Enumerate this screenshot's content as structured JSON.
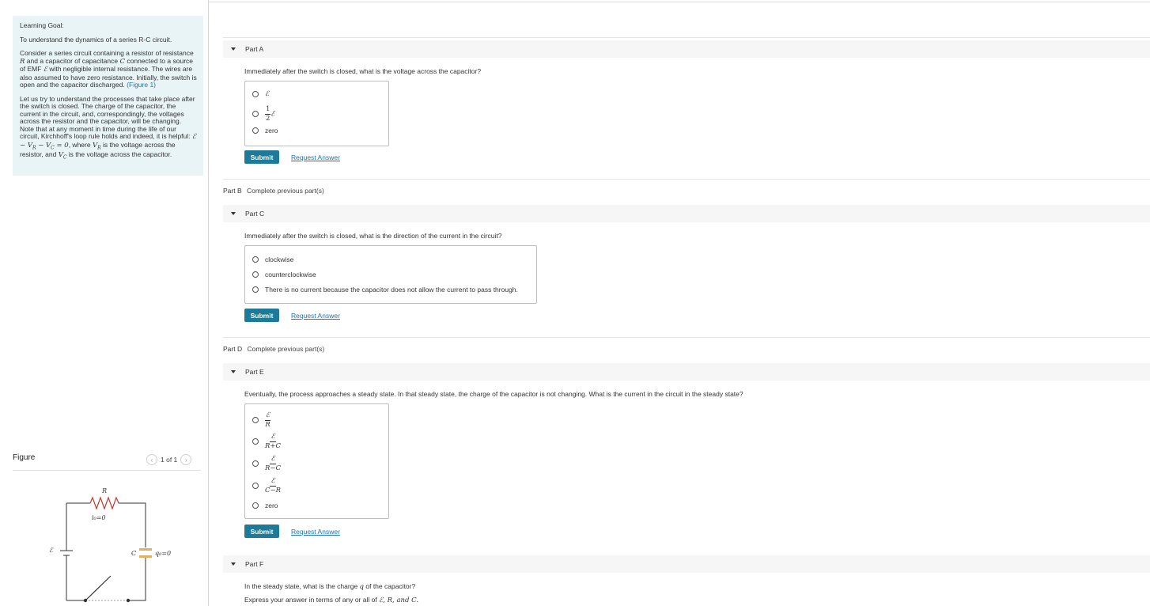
{
  "learning_goal": {
    "heading": "Learning Goal:",
    "intro": "To understand the dynamics of a series R-C circuit.",
    "p2_a": "Consider a series circuit containing a resistor of resistance",
    "p2_b": "and a capacitor of capacitance",
    "p2_c": "connected to a source of EMF",
    "p2_d": "with negligible internal resistance. The wires are also assumed to have zero resistance. Initially, the switch is open and the capacitor discharged.",
    "figure_link": "(Figure 1)",
    "p3_a": "Let us try to understand the processes that take place after the switch is closed. The charge of the capacitor, the current in the circuit, and, correspondingly, the voltages across the resistor and the capacitor, will be changing. Note that at any moment in time during the life of our circuit, Kirchhoff's loop rule holds and indeed, it is helpful:",
    "p3_b": ", where",
    "p3_c": "is the voltage across the resistor, and",
    "p3_d": "is the voltage across the capacitor.",
    "sym_R": "R",
    "sym_C": "C",
    "sym_emf": "ℰ",
    "kirchhoff_eq": "ℰ − V",
    "eq_R_sub": "R",
    "eq_mid": " − V",
    "eq_C_sub": "C",
    "eq_end": " = 0",
    "V": "V"
  },
  "figure": {
    "title": "Figure",
    "pager": "1 of 1",
    "prev": "‹",
    "next": "›",
    "label_R": "R",
    "label_i0": "i₀=0",
    "label_C": "C",
    "label_q0": "q₀=0",
    "label_emf": "ℰ"
  },
  "parts": {
    "A": {
      "label": "Part A",
      "question": "Immediately after the switch is closed, what is the voltage across the capacitor?",
      "options": [
        "ℰ",
        "½ℰ",
        "zero"
      ],
      "opt2_num": "1",
      "opt2_den": "2",
      "submit": "Submit",
      "request": "Request Answer"
    },
    "B": {
      "label": "Part B",
      "status": "Complete previous part(s)"
    },
    "C": {
      "label": "Part C",
      "question": "Immediately after the switch is closed, what is the direction of the current in the circuit?",
      "options": [
        "clockwise",
        "counterclockwise",
        "There is no current because the capacitor does not allow the current to pass through."
      ],
      "submit": "Submit",
      "request": "Request Answer"
    },
    "D": {
      "label": "Part D",
      "status": "Complete previous part(s)"
    },
    "E": {
      "label": "Part E",
      "question": "Eventually, the process approaches a steady state. In that steady state, the charge of the capacitor is not changing. What is the current in the circuit in the steady state?",
      "fractions": [
        {
          "num": "ℰ",
          "den": "R"
        },
        {
          "num": "ℰ",
          "den": "R+C"
        },
        {
          "num": "ℰ",
          "den": "R−C"
        },
        {
          "num": "ℰ",
          "den": "C−R"
        }
      ],
      "last_option": "zero",
      "submit": "Submit",
      "request": "Request Answer"
    },
    "F": {
      "label": "Part F",
      "question_a": "In the steady state, what is the charge",
      "question_q": "q",
      "question_b": "of the capacitor?",
      "express_a": "Express your answer in terms of any or all of",
      "express_vars": "ℰ, R, and C."
    }
  },
  "colors": {
    "goal_bg": "#e9f4f6",
    "submit_bg": "#1e7a99",
    "link": "#1a73b8",
    "capacitor": "#e0b060"
  }
}
